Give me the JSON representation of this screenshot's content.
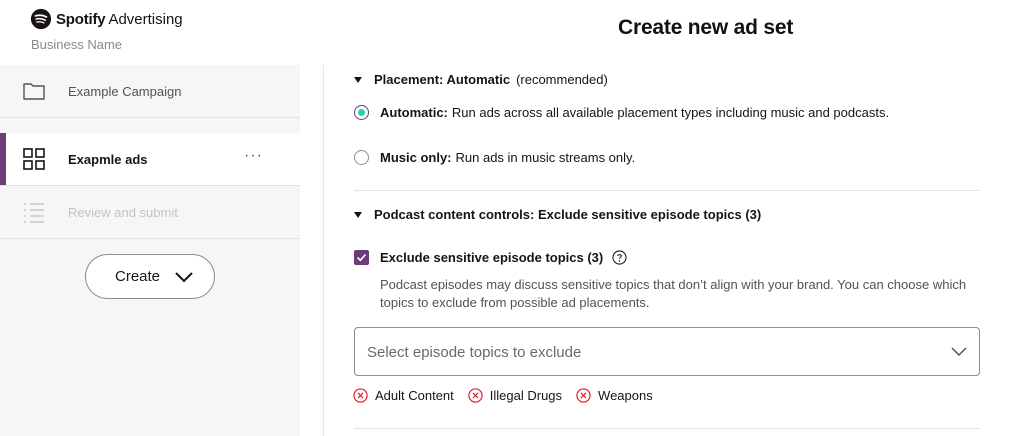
{
  "header": {
    "brand_name": "Spotify",
    "brand_sub": "Advertising",
    "business_name": "Business Name",
    "page_title": "Create new ad set"
  },
  "sidebar": {
    "items": [
      {
        "label": "Example Campaign",
        "icon": "folder-icon",
        "state": "normal"
      },
      {
        "label": "Exapmle ads",
        "icon": "grid-icon",
        "state": "active",
        "more": "···"
      },
      {
        "label": "Review and submit",
        "icon": "list-icon",
        "state": "disabled"
      }
    ],
    "create_label": "Create"
  },
  "placement": {
    "title": "Placement: Automatic",
    "recommended": "(recommended)",
    "options": [
      {
        "bold": "Automatic:",
        "text": "Run ads across all available placement types including music and podcasts.",
        "checked": true
      },
      {
        "bold": "Music only:",
        "text": "Run ads in music streams only.",
        "checked": false
      }
    ]
  },
  "podcast": {
    "title": "Podcast content controls: Exclude sensitive episode topics (3)",
    "checkbox_label": "Exclude sensitive episode topics (3)",
    "checked": true,
    "description": "Podcast episodes may discuss sensitive topics that don’t align with your brand. You can choose which topics to exclude from possible ad placements.",
    "select_placeholder": "Select episode topics to exclude",
    "chips": [
      "Adult Content",
      "Illegal Drugs",
      "Weapons"
    ]
  },
  "colors": {
    "accent": "#6b3b7a",
    "radio_dot": "#1ed3b3",
    "chip_x": "#e22134"
  }
}
